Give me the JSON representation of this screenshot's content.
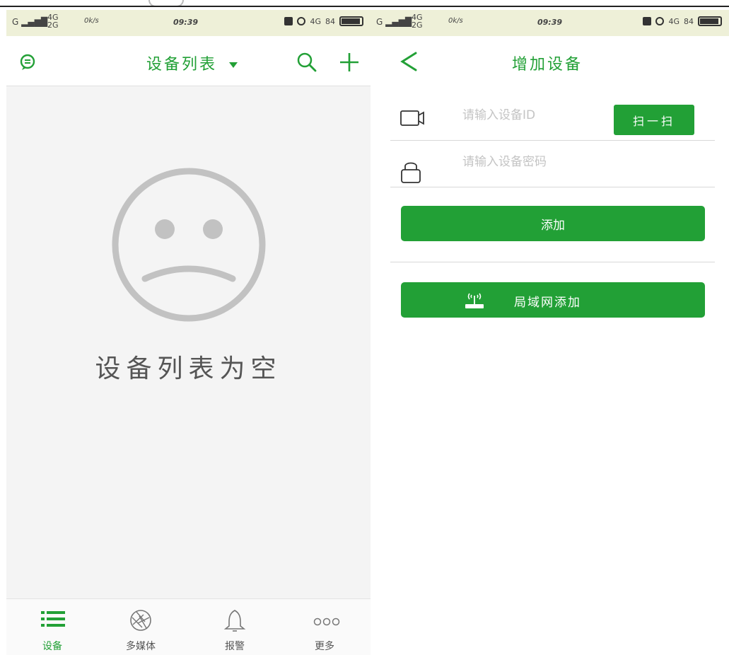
{
  "status_left": {
    "carrier1": "G",
    "net_top": "4G",
    "net_bottom": "2G",
    "speed": "0k/s",
    "time": "09:39",
    "net2": "4G",
    "battery_pct": "84"
  },
  "status_right": {
    "carrier1": "G",
    "net_top": "4G",
    "net_bottom": "2G",
    "speed": "0k/s",
    "time": "09:39",
    "net2": "4G",
    "battery_pct": "84"
  },
  "device_list": {
    "title": "设备列表",
    "empty_message": "设备列表为空",
    "icons": {
      "message": "message-bubble-icon",
      "dropdown": "caret-down-icon",
      "search": "search-icon",
      "add": "plus-icon",
      "empty": "sad-face-icon"
    }
  },
  "tabs": [
    {
      "label": "设备",
      "icon": "list-icon",
      "active": true
    },
    {
      "label": "多媒体",
      "icon": "aperture-icon",
      "active": false
    },
    {
      "label": "报警",
      "icon": "bell-icon",
      "active": false
    },
    {
      "label": "更多",
      "icon": "more-dots-icon",
      "active": false
    }
  ],
  "add_device": {
    "title": "增加设备",
    "device_id_placeholder": "请输入设备ID",
    "password_placeholder": "请输入设备密码",
    "scan_label": "扫一扫",
    "add_label": "添加",
    "lan_add_label": "局域网添加",
    "icons": {
      "back": "chevron-left-icon",
      "camera": "video-camera-icon",
      "lock": "lock-icon",
      "router": "wifi-router-icon"
    }
  },
  "colors": {
    "accent": "#22a036",
    "status_bar": "#eef0d8"
  }
}
